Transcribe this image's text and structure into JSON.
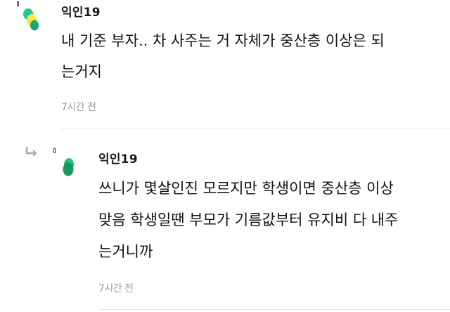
{
  "comments": [
    {
      "author": "익인19",
      "lines": [
        "내 기준 부자.. 차 사주는 거 자체가 중산층 이상은 되",
        "는거지"
      ],
      "time": "7시간 전",
      "avatar_icon": "user-avatar-icon",
      "avatar_colors": [
        "#1fc9a0",
        "#f5e93c",
        "#17a878"
      ]
    },
    {
      "author": "익인19",
      "lines": [
        "쓰니가 몇살인진 모르지만 학생이면 중산층 이상",
        "맞음 학생일땐 부모가 기름값부터 유지비 다 내주",
        "는거니까"
      ],
      "time": "7시간 전",
      "is_reply": true,
      "reply_icon": "reply-arrow-icon",
      "avatar_icon": "user-avatar-icon",
      "avatar_colors": [
        "#21b872",
        "#1a9e60"
      ]
    }
  ],
  "colors": {
    "text": "#111111",
    "meta": "#9a9a9a",
    "divider": "#e4e4e4",
    "reply_arrow": "#b0b0b0"
  }
}
